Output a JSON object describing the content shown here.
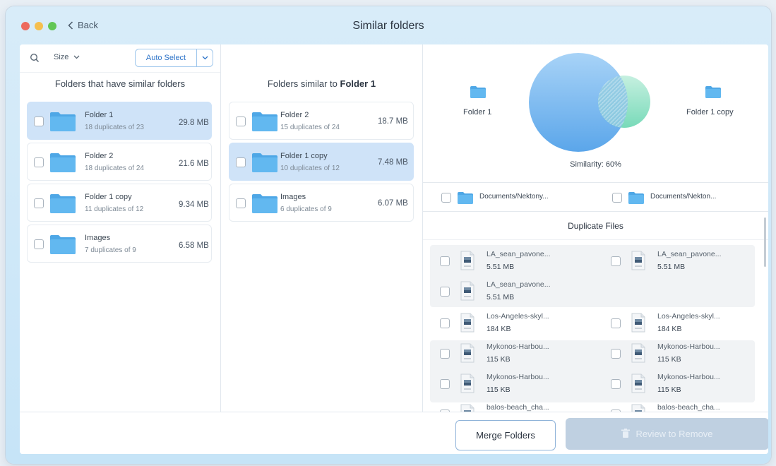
{
  "titlebar": {
    "back_label": "Back",
    "title": "Similar folders",
    "traffic_colors": [
      "#ed6a5e",
      "#f5bf4f",
      "#62c655"
    ]
  },
  "left_pane": {
    "sort_label": "Size",
    "auto_select_label": "Auto Select",
    "heading": "Folders that have similar folders",
    "items": [
      {
        "name": "Folder 1",
        "sub": "18 duplicates of 23",
        "size": "29.8 MB",
        "selected": true
      },
      {
        "name": "Folder 2",
        "sub": "18 duplicates of 24",
        "size": "21.6 MB",
        "selected": false
      },
      {
        "name": "Folder 1 copy",
        "sub": "11 duplicates of 12",
        "size": "9.34 MB",
        "selected": false
      },
      {
        "name": "Images",
        "sub": "7 duplicates of 9",
        "size": "6.58 MB",
        "selected": false
      }
    ]
  },
  "middle_pane": {
    "heading_prefix": "Folders similar to ",
    "heading_bold": "Folder 1",
    "items": [
      {
        "name": "Folder 2",
        "sub": "15 duplicates of 24",
        "size": "18.7 MB",
        "selected": false
      },
      {
        "name": "Folder 1 copy",
        "sub": "10 duplicates of 12",
        "size": "7.48 MB",
        "selected": true
      },
      {
        "name": "Images",
        "sub": "6 duplicates of 9",
        "size": "6.07 MB",
        "selected": false
      }
    ]
  },
  "comparison": {
    "left_label": "Folder 1",
    "right_label": "Folder 1 copy",
    "similarity_label": "Similarity: 60%",
    "similarity_percent": 60,
    "left_path": "Documents/Nektony...",
    "right_path": "Documents/Nekton..."
  },
  "duplicates": {
    "heading": "Duplicate Files",
    "rows": [
      {
        "left": {
          "name": "LA_sean_pavone...",
          "size": "5.51 MB"
        },
        "right": {
          "name": "LA_sean_pavone...",
          "size": "5.51 MB"
        }
      },
      {
        "left": {
          "name": "LA_sean_pavone...",
          "size": "5.51 MB"
        },
        "right": null
      },
      {
        "left": {
          "name": "Los-Angeles-skyl...",
          "size": "184 KB"
        },
        "right": {
          "name": "Los-Angeles-skyl...",
          "size": "184 KB"
        }
      },
      {
        "left": {
          "name": "Mykonos-Harbou...",
          "size": "115 KB"
        },
        "right": {
          "name": "Mykonos-Harbou...",
          "size": "115 KB"
        }
      },
      {
        "left": {
          "name": "Mykonos-Harbou...",
          "size": "115 KB"
        },
        "right": {
          "name": "Mykonos-Harbou...",
          "size": "115 KB"
        }
      },
      {
        "left": {
          "name": "balos-beach_cha...",
          "size": ""
        },
        "right": {
          "name": "balos-beach_cha...",
          "size": ""
        }
      }
    ]
  },
  "footer": {
    "merge_label": "Merge Folders",
    "review_label": "Review to Remove"
  },
  "colors": {
    "accent": "#2e74c9",
    "folder": "#5bb1ea",
    "selection": "#cfe3f8",
    "venn_left": "#6fb3ec",
    "venn_right": "#8ae0c8"
  }
}
